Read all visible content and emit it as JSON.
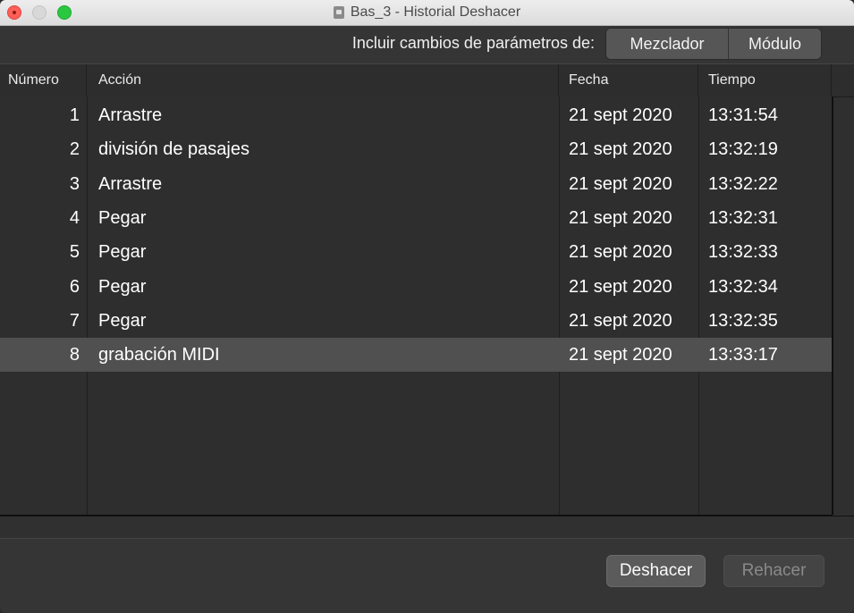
{
  "window": {
    "title": "Bas_3 - Historial Deshacer"
  },
  "toolbar": {
    "include_label": "Incluir cambios de parámetros de:",
    "segments": [
      "Mezclador",
      "Módulo"
    ]
  },
  "table": {
    "columns": [
      "Número",
      "Acción",
      "Fecha",
      "Tiempo"
    ],
    "rows": [
      {
        "num": "1",
        "action": "Arrastre",
        "date": "21 sept 2020",
        "time": "13:31:54"
      },
      {
        "num": "2",
        "action": "división de pasajes",
        "date": "21 sept 2020",
        "time": "13:32:19"
      },
      {
        "num": "3",
        "action": "Arrastre",
        "date": "21 sept 2020",
        "time": "13:32:22"
      },
      {
        "num": "4",
        "action": "Pegar",
        "date": "21 sept 2020",
        "time": "13:32:31"
      },
      {
        "num": "5",
        "action": "Pegar",
        "date": "21 sept 2020",
        "time": "13:32:33"
      },
      {
        "num": "6",
        "action": "Pegar",
        "date": "21 sept 2020",
        "time": "13:32:34"
      },
      {
        "num": "7",
        "action": "Pegar",
        "date": "21 sept 2020",
        "time": "13:32:35"
      },
      {
        "num": "8",
        "action": "grabación MIDI",
        "date": "21 sept 2020",
        "time": "13:33:17"
      }
    ],
    "selected_row": 8
  },
  "footer": {
    "undo_label": "Deshacer",
    "redo_label": "Rehacer"
  },
  "icons": {
    "close": "close-icon",
    "minimize": "minimize-icon",
    "maximize": "maximize-icon",
    "document": "document-icon"
  }
}
